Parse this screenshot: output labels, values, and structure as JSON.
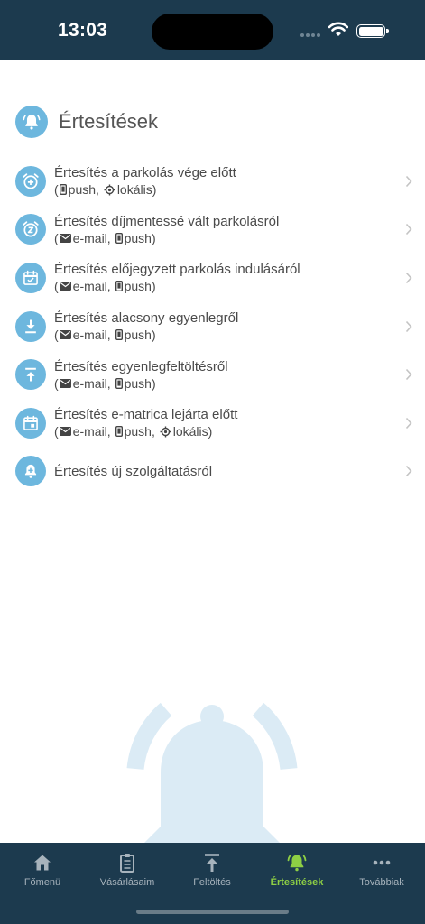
{
  "status": {
    "time": "13:03"
  },
  "page": {
    "title": "Értesítések",
    "icon": "bell-ring-icon"
  },
  "notifications": [
    {
      "title": "Értesítés a parkolás vége előtt",
      "icon": "alarm-plus-icon",
      "channels": [
        {
          "icon": "phone-icon",
          "label": "push"
        },
        {
          "icon": "location-target-icon",
          "label": "lokális"
        }
      ]
    },
    {
      "title": "Értesítés díjmentessé vált parkolásról",
      "icon": "alarm-snooze-icon",
      "channels": [
        {
          "icon": "envelope-icon",
          "label": "e-mail"
        },
        {
          "icon": "phone-icon",
          "label": "push"
        }
      ]
    },
    {
      "title": "Értesítés előjegyzett parkolás indulásáról",
      "icon": "calendar-check-icon",
      "channels": [
        {
          "icon": "envelope-icon",
          "label": "e-mail"
        },
        {
          "icon": "phone-icon",
          "label": "push"
        }
      ]
    },
    {
      "title": "Értesítés alacsony egyenlegről",
      "icon": "download-icon",
      "channels": [
        {
          "icon": "envelope-icon",
          "label": "e-mail"
        },
        {
          "icon": "phone-icon",
          "label": "push"
        }
      ]
    },
    {
      "title": "Értesítés egyenlegfeltöltésről",
      "icon": "upload-icon",
      "channels": [
        {
          "icon": "envelope-icon",
          "label": "e-mail"
        },
        {
          "icon": "phone-icon",
          "label": "push"
        }
      ]
    },
    {
      "title": "Értesítés e-matrica lejárta előtt",
      "icon": "calendar-icon",
      "channels": [
        {
          "icon": "envelope-icon",
          "label": "e-mail"
        },
        {
          "icon": "phone-icon",
          "label": "push"
        },
        {
          "icon": "location-target-icon",
          "label": "lokális"
        }
      ]
    },
    {
      "title": "Értesítés új szolgáltatásról",
      "icon": "bell-plus-icon",
      "channels": []
    }
  ],
  "tabs": [
    {
      "label": "Főmenü",
      "icon": "home-icon",
      "active": false
    },
    {
      "label": "Vásárlásaim",
      "icon": "clipboard-icon",
      "active": false
    },
    {
      "label": "Feltöltés",
      "icon": "upload-icon",
      "active": false
    },
    {
      "label": "Értesítések",
      "icon": "bell-ring-icon",
      "active": true
    },
    {
      "label": "Továbbiak",
      "icon": "more-dots-icon",
      "active": false
    }
  ],
  "colors": {
    "status_bar": "#1c3a4e",
    "accent_blue": "#6db7de",
    "tab_active": "#8ecf44",
    "tab_inactive": "#a7b3bc",
    "background_bell": "#dbebf5"
  }
}
